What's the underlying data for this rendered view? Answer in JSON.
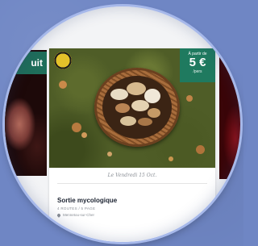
{
  "cards": {
    "left": {
      "ribbon_text": "uit"
    },
    "main": {
      "price": {
        "from_label": "À partir de",
        "value": "5 €",
        "per_label": "/pers"
      },
      "date": "Le Vendredi 15 Oct.",
      "title": "Sortie mycologique",
      "subtitle": "4 ROUTES / 5 PAGE",
      "location": "Mennetou-sur-Cher",
      "badge": "gold-medal-icon"
    }
  },
  "colors": {
    "background": "#6f86c4",
    "accent_green": "#1f7a5f",
    "card": "#ffffff"
  }
}
